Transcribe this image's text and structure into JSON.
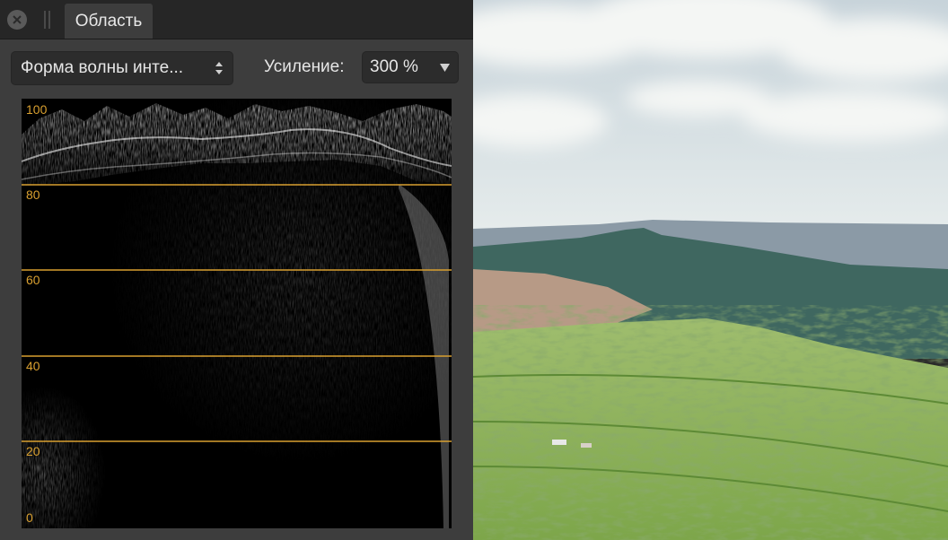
{
  "panel": {
    "tab_label": "Область",
    "mode_select": {
      "value": "Форма волны инте..."
    },
    "gain": {
      "label": "Усиление:",
      "value": "300 %"
    }
  },
  "scope": {
    "type": "luma-waveform",
    "y_range": [
      0,
      100
    ],
    "tick_labels": [
      "100",
      "80",
      "60",
      "40",
      "20",
      "0"
    ],
    "guide_lines_at": [
      80,
      60,
      40,
      20
    ],
    "colors": {
      "guide": "#d9a030",
      "trace": "#ffffff",
      "background": "#000000"
    }
  },
  "colors": {
    "panel_bg": "#3d3d3d",
    "tabbar_bg": "#262626",
    "control_bg": "#2c2c2c",
    "text": "#e6e6e6"
  },
  "icons": {
    "close": "close-icon",
    "grip": "drag-handle-icon",
    "stepper": "updown-arrows-icon",
    "dropdown": "caret-down-icon"
  }
}
